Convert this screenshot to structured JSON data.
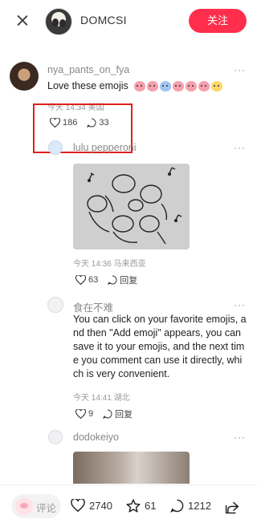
{
  "header": {
    "username": "DOMCSI",
    "follow_label": "关注"
  },
  "comments": [
    {
      "username": "nya_pants_on_fya",
      "text": "Love these emojis",
      "time": "今天 14:34",
      "location": "美国",
      "likes": "186",
      "replies": "33",
      "more": "···"
    },
    {
      "username": "lulu pepperoni",
      "time": "今天 14:36",
      "location": "马来西亚",
      "likes": "63",
      "reply_label": "回复",
      "more": "···"
    },
    {
      "username": "食在不难",
      "text": "You can click on your favorite emojis, and then \"Add emoji\" appears, you can save it to your emojis, and the next time you comment can use it directly, which is very convenient.",
      "time": "今天 14:41",
      "location": "湖北",
      "likes": "9",
      "reply_label": "回复",
      "more": "···"
    },
    {
      "username": "dodokeiyo",
      "more": "···"
    }
  ],
  "bottom_bar": {
    "comment_placeholder": "评论",
    "likes": "2740",
    "favorites": "61",
    "comments": "1212"
  },
  "colors": {
    "accent": "#ff2e4d",
    "highlight": "#e0201b"
  }
}
